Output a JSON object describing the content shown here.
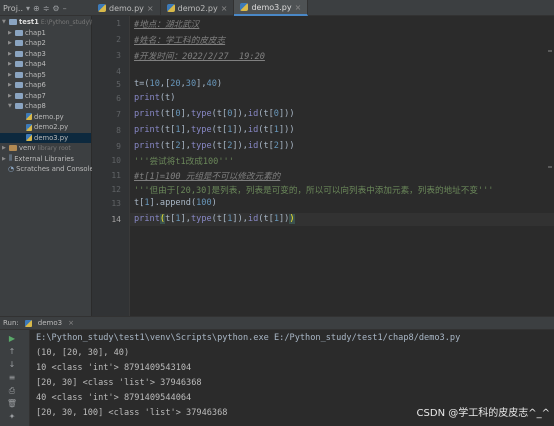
{
  "project_header": {
    "label": "Proj..",
    "icons": [
      "globe-icon",
      "sort-icon",
      "gear-icon",
      "minus-icon"
    ]
  },
  "tabs": [
    {
      "label": "demo.py",
      "active": false
    },
    {
      "label": "demo2.py",
      "active": false
    },
    {
      "label": "demo3.py",
      "active": true
    }
  ],
  "tree": [
    {
      "label": "test1",
      "extra": "E:\\Python_study\\te",
      "level": 0,
      "kind": "folder",
      "open": true
    },
    {
      "label": "chap1",
      "level": 1,
      "kind": "folder"
    },
    {
      "label": "chap2",
      "level": 1,
      "kind": "folder"
    },
    {
      "label": "chap3",
      "level": 1,
      "kind": "folder"
    },
    {
      "label": "chap4",
      "level": 1,
      "kind": "folder"
    },
    {
      "label": "chap5",
      "level": 1,
      "kind": "folder"
    },
    {
      "label": "chap6",
      "level": 1,
      "kind": "folder"
    },
    {
      "label": "chap7",
      "level": 1,
      "kind": "folder"
    },
    {
      "label": "chap8",
      "level": 1,
      "kind": "folder",
      "open": true
    },
    {
      "label": "demo.py",
      "level": 2,
      "kind": "file"
    },
    {
      "label": "demo2.py",
      "level": 2,
      "kind": "file"
    },
    {
      "label": "demo3.py",
      "level": 2,
      "kind": "file",
      "selected": true
    },
    {
      "label": "venv",
      "extra": "library root",
      "level": 1,
      "kind": "folder"
    },
    {
      "label": "External Libraries",
      "level": 0,
      "kind": "lib"
    },
    {
      "label": "Scratches and Consoles",
      "level": 0,
      "kind": "scratch"
    }
  ],
  "line_numbers": [
    "1",
    "2",
    "3",
    "4",
    "5",
    "6",
    "7",
    "8",
    "9",
    "10",
    "11",
    "12",
    "13",
    "14"
  ],
  "code": {
    "l1": "#地点：湖北武汉",
    "l2": "#姓名：学工科的皮皮志",
    "l3": "#开发时间：2022/2/27  19:20",
    "l5a": "t=(",
    "l5b": "10",
    "l5c": ",[",
    "l5d": "20",
    "l5e": ",",
    "l5f": "30",
    "l5g": "],",
    "l5h": "40",
    "l5i": ")",
    "l6a": "print",
    "l6b": "(t)",
    "l7a": "print",
    "l7b": "(t[",
    "l7c": "0",
    "l7d": "],",
    "l7e": "type",
    "l7f": "(t[",
    "l7g": "0",
    "l7h": "]),",
    "l7i": "id",
    "l7j": "(t[",
    "l7k": "0",
    "l7l": "]))",
    "l8a": "print",
    "l8b": "(t[",
    "l8c": "1",
    "l8d": "],",
    "l8e": "type",
    "l8f": "(t[",
    "l8g": "1",
    "l8h": "]),",
    "l8i": "id",
    "l8j": "(t[",
    "l8k": "1",
    "l8l": "]))",
    "l9a": "print",
    "l9b": "(t[",
    "l9c": "2",
    "l9d": "],",
    "l9e": "type",
    "l9f": "(t[",
    "l9g": "2",
    "l9h": "]),",
    "l9i": "id",
    "l9j": "(t[",
    "l9k": "2",
    "l9l": "]))",
    "l10": "'''尝试将t1改成100'''",
    "l11": "#t[1]=100 元组是不可以修改元素的",
    "l12": "'''但由于[20,30]是列表，列表是可变的，所以可以向列表中添加元素，列表的地址不变'''",
    "l13a": "t[",
    "l13b": "1",
    "l13c": "].append(",
    "l13d": "100",
    "l13e": ")",
    "l14a": "print",
    "l14b": "(",
    "l14c": "t[",
    "l14d": "1",
    "l14e": "],",
    "l14f": "type",
    "l14g": "(t[",
    "l14h": "1",
    "l14i": "]),",
    "l14j": "id",
    "l14k": "(t[",
    "l14l": "1",
    "l14m": "])",
    "l14n": ")"
  },
  "run_panel": {
    "label": "Run:",
    "config": "demo3",
    "close": "×"
  },
  "console": [
    "E:\\Python_study\\test1\\venv\\Scripts\\python.exe E:/Python_study/test1/chap8/demo3.py",
    "(10, [20, 30], 40)",
    "10 <class 'int'> 8791409543104",
    "[20, 30] <class 'list'> 37946368",
    "40 <class 'int'> 8791409544064",
    "[20, 30, 100] <class 'list'> 37946368"
  ],
  "watermark": "CSDN @学工科的皮皮志^_^"
}
